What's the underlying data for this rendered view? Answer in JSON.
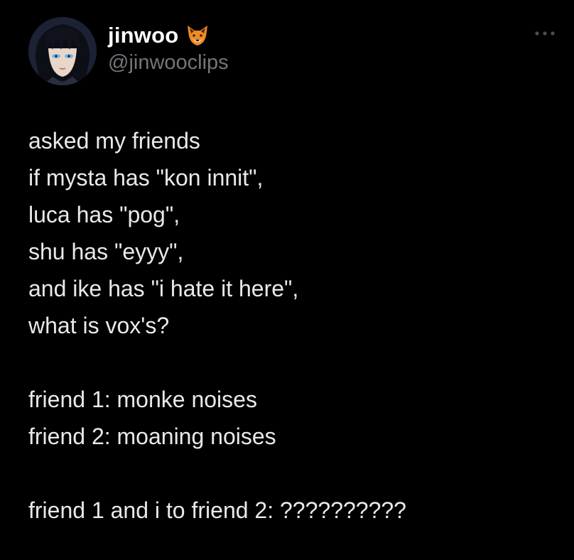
{
  "author": {
    "display_name": "jinwoo",
    "handle": "@jinwooclips",
    "name_emoji": "fox-face-emoji",
    "avatar": "anime-avatar"
  },
  "menu_icon": "more-options-icon",
  "text_lines": [
    "asked my friends",
    "if mysta has \"kon innit\",",
    "luca has \"pog\",",
    "shu has \"eyyy\",",
    "and ike has \"i hate it here\",",
    "what is vox's?",
    "",
    "friend 1: monke noises",
    "friend 2: moaning noises",
    "",
    "friend 1 and i to friend 2: ??????????"
  ],
  "colors": {
    "background": "#000000",
    "text": "#e7e9ea",
    "handle": "#71767b",
    "name": "#ffffff"
  }
}
